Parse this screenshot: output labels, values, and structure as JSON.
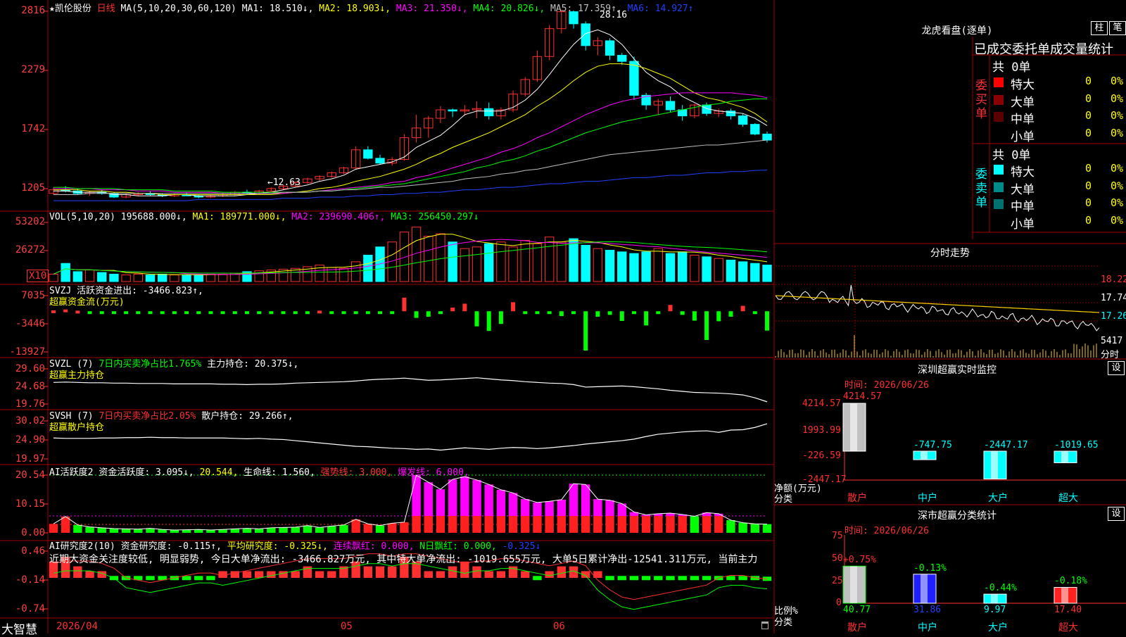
{
  "main_header": {
    "stock_name": "★凯伦股份",
    "period": "日线",
    "ma_params": "MA(5,10,20,30,60,120)",
    "ma1": "MA1: 18.510↓,",
    "ma2": "MA2: 18.903↓,",
    "ma3": "MA3: 21.350↓,",
    "ma4": "MA4: 20.826↓,",
    "ma5": "MA5: 17.359↑,",
    "ma6": "MA6: 14.927↑",
    "high_marker": "28.16",
    "low_marker": "←12.63"
  },
  "main_yaxis": [
    "2816",
    "2279",
    "1742",
    "1205"
  ],
  "vol_header": {
    "label": "VOL(5,10,20)",
    "vol": "195688.000↓,",
    "ma1": "MA1: 189771.000↓,",
    "ma2": "MA2: 239690.406↑,",
    "ma3": "MA3: 256450.297↓"
  },
  "vol_yaxis": [
    "53202",
    "26272"
  ],
  "vol_unit": "X10",
  "svzj": {
    "line1": "SVZJ  活跃资金进出: -3466.823↑,",
    "line2": "超赢资金流(万元)"
  },
  "svzj_yaxis": [
    "7035",
    "-3446",
    "-13927"
  ],
  "svzl": {
    "label": "SVZL (7)",
    "ratio": "7日内买卖净占比1.765%",
    "hold": "主力持仓: 20.375↓,",
    "line2": "超赢主力持仓"
  },
  "svzl_yaxis": [
    "29.60",
    "24.68",
    "19.76"
  ],
  "svsh": {
    "label": "SVSH (7)",
    "ratio": "7日内买卖净占比2.05%",
    "hold": "散户持仓: 29.266↑,",
    "line2": "超赢散户持仓"
  },
  "svsh_yaxis": [
    "30.02",
    "24.90",
    "19.97"
  ],
  "ai_active": {
    "label": "AI活跃度2",
    "a": "资金活跃度: 3.095↓,",
    "b": "20.544,",
    "c": "生命线: 1.560,",
    "d": "强势线: 3.000,",
    "e": "爆发线: 6.000,"
  },
  "ai_active_yaxis": [
    "20.54",
    "10.15",
    "0.00"
  ],
  "ai_research": {
    "label": "AI研究度2(10)",
    "a": "资金研究度: -0.115↑,",
    "b": "平均研究度: -0.325↓,",
    "c": "连续飘红: 0.000,",
    "d": "N日飘红: 0.000,",
    "e": "-0.325↓",
    "note": "近期大资金关注度较低, 明显弱势, 今日大单净流出: -3466.827万元, 其中特大单净流出: -1019.655万元, 大单5日累计净出-12541.311万元, 当前主力"
  },
  "ai_research_yaxis": [
    "0.46",
    "-0.14",
    "-0.74"
  ],
  "xaxis": {
    "brand": "大智慧",
    "labels": [
      "2026/04",
      "05",
      "06"
    ]
  },
  "dragon_panel": {
    "title": "龙虎看盘(逐单)",
    "btn1": "柱",
    "btn2": "笔",
    "subtitle": "已成交委托单成交量统计",
    "buy_total": "共 0单",
    "buy_label": "委买单",
    "sell_total": "共 0单",
    "sell_label": "委卖单",
    "buy_rows": [
      {
        "name": "特大",
        "count": "0",
        "pct": "0%",
        "color": "#ff0000"
      },
      {
        "name": "大单",
        "count": "0",
        "pct": "0%",
        "color": "#8b0000"
      },
      {
        "name": "中单",
        "count": "0",
        "pct": "0%",
        "color": "#5a0000"
      },
      {
        "name": "小单",
        "count": "0",
        "pct": "0%",
        "color": ""
      }
    ],
    "sell_rows": [
      {
        "name": "特大",
        "count": "0",
        "pct": "0%",
        "color": "#00ffff"
      },
      {
        "name": "大单",
        "count": "0",
        "pct": "0%",
        "color": "#008b8b"
      },
      {
        "name": "中单",
        "count": "0",
        "pct": "0%",
        "color": "#007070"
      },
      {
        "name": "小单",
        "count": "0",
        "pct": "0%",
        "color": ""
      }
    ]
  },
  "intraday": {
    "title": "分时走势",
    "yaxis": [
      "18.22",
      "17.74",
      "17.26"
    ],
    "vol_value": "5417",
    "vol_label": "分时"
  },
  "sz_monitor": {
    "title": "深圳超赢实时监控",
    "btn": "设",
    "time": "时间: 2026/06/26",
    "yaxis": [
      "4214.57",
      "1993.99",
      "-226.59",
      "-2447.17"
    ],
    "ylabel": "净额(万元)",
    "xlabel": "分类",
    "values": [
      "4214.57",
      "-747.75",
      "-2447.17",
      "-1019.65"
    ],
    "categories": [
      "散户",
      "中户",
      "大户",
      "超大"
    ]
  },
  "sz_class": {
    "title": "深市超赢分类统计",
    "btn": "设",
    "time": "时间: 2026/06/26",
    "yaxis": [
      "75",
      "50",
      "25",
      "0"
    ],
    "ylabel": "比例%",
    "xlabel": "分类",
    "changes": [
      "+0.75%",
      "-0.13%",
      "-0.44%",
      "-0.18%"
    ],
    "values": [
      "40.77",
      "31.86",
      "9.97",
      "17.40"
    ],
    "categories": [
      "散户",
      "中户",
      "大户",
      "超大"
    ]
  },
  "colors": {
    "up": "#ff3030",
    "down": "#00ffff",
    "ma1": "#ffffff",
    "ma2": "#ffff00",
    "ma3": "#ff00ff",
    "ma4": "#00ff00",
    "ma5": "#c0c0c0",
    "ma6": "#2040ff",
    "border": "#a00000"
  },
  "chart_data": {
    "type": "candlestick",
    "candles": [
      [
        13.0,
        13.5,
        12.9,
        13.3
      ],
      [
        13.3,
        13.6,
        13.1,
        13.2
      ],
      [
        13.2,
        13.4,
        12.9,
        13.0
      ],
      [
        13.0,
        13.2,
        12.8,
        13.1
      ],
      [
        13.1,
        13.3,
        12.9,
        13.0
      ],
      [
        13.0,
        13.1,
        12.63,
        12.7
      ],
      [
        12.7,
        13.0,
        12.6,
        12.9
      ],
      [
        12.9,
        13.1,
        12.8,
        13.0
      ],
      [
        13.0,
        13.2,
        12.8,
        12.9
      ],
      [
        12.9,
        13.0,
        12.7,
        12.8
      ],
      [
        12.8,
        13.0,
        12.7,
        12.9
      ],
      [
        12.9,
        13.1,
        12.8,
        12.8
      ],
      [
        12.8,
        12.9,
        12.6,
        12.7
      ],
      [
        12.7,
        12.9,
        12.63,
        12.8
      ],
      [
        12.8,
        13.0,
        12.7,
        12.9
      ],
      [
        12.9,
        13.2,
        12.8,
        13.1
      ],
      [
        13.1,
        13.3,
        12.9,
        13.0
      ],
      [
        13.0,
        13.3,
        12.9,
        13.2
      ],
      [
        13.2,
        13.5,
        13.1,
        13.4
      ],
      [
        13.4,
        13.7,
        13.3,
        13.6
      ],
      [
        13.6,
        14.0,
        13.5,
        13.9
      ],
      [
        13.9,
        14.3,
        13.8,
        14.2
      ],
      [
        14.2,
        14.5,
        14.0,
        14.4
      ],
      [
        14.4,
        14.8,
        14.3,
        14.7
      ],
      [
        14.7,
        15.2,
        14.6,
        15.1
      ],
      [
        15.1,
        16.9,
        15.0,
        16.6
      ],
      [
        16.6,
        16.9,
        15.8,
        15.9
      ],
      [
        15.9,
        16.2,
        15.4,
        15.5
      ],
      [
        15.5,
        16.0,
        15.3,
        15.8
      ],
      [
        15.8,
        17.9,
        15.7,
        17.6
      ],
      [
        17.6,
        19.5,
        17.2,
        18.4
      ],
      [
        18.4,
        19.4,
        17.6,
        19.2
      ],
      [
        19.2,
        20.2,
        18.8,
        19.9
      ],
      [
        19.9,
        20.0,
        19.3,
        19.8
      ],
      [
        19.8,
        20.3,
        19.4,
        19.9
      ],
      [
        19.9,
        20.6,
        19.2,
        20.0
      ],
      [
        20.0,
        20.5,
        19.1,
        19.4
      ],
      [
        19.4,
        20.1,
        19.1,
        19.9
      ],
      [
        19.9,
        21.5,
        19.7,
        21.2
      ],
      [
        21.2,
        22.6,
        21.0,
        22.4
      ],
      [
        22.4,
        24.8,
        22.2,
        24.3
      ],
      [
        24.3,
        26.9,
        24.0,
        26.6
      ],
      [
        26.6,
        28.16,
        26.2,
        28.0
      ],
      [
        28.0,
        28.1,
        26.6,
        27.0
      ],
      [
        27.0,
        27.2,
        24.8,
        25.2
      ],
      [
        25.2,
        25.9,
        24.4,
        25.6
      ],
      [
        25.6,
        25.8,
        24.0,
        24.4
      ],
      [
        24.4,
        24.6,
        23.6,
        23.9
      ],
      [
        23.9,
        24.3,
        20.7,
        21.1
      ],
      [
        21.1,
        21.3,
        19.9,
        20.3
      ],
      [
        20.3,
        20.8,
        19.5,
        20.6
      ],
      [
        20.6,
        21.0,
        19.7,
        19.9
      ],
      [
        19.9,
        20.3,
        19.0,
        19.4
      ],
      [
        19.4,
        20.4,
        19.2,
        20.3
      ],
      [
        20.3,
        20.5,
        19.4,
        19.6
      ],
      [
        19.6,
        20.0,
        19.3,
        19.8
      ],
      [
        19.8,
        20.0,
        19.1,
        19.4
      ],
      [
        19.4,
        19.6,
        18.5,
        18.7
      ],
      [
        18.7,
        18.8,
        17.8,
        17.9
      ],
      [
        17.9,
        18.1,
        17.2,
        17.4
      ]
    ],
    "ma": {
      "MA1": [
        13.2,
        13.2,
        13.1,
        13.1,
        13.1,
        12.9,
        12.9,
        12.8,
        12.8,
        12.8,
        12.9,
        12.9,
        12.8,
        12.8,
        12.8,
        12.8,
        12.9,
        13.0,
        13.1,
        13.3,
        13.5,
        13.7,
        14.0,
        14.2,
        14.5,
        15.0,
        15.2,
        15.4,
        15.6,
        16.0,
        16.8,
        17.3,
        17.8,
        18.6,
        19.5,
        19.8,
        19.8,
        19.8,
        20.1,
        20.7,
        21.6,
        22.8,
        24.1,
        25.3,
        26.2,
        26.5,
        26.1,
        25.3,
        24.1,
        23.0,
        22.3,
        21.8,
        21.0,
        20.5,
        20.0,
        19.8,
        19.7,
        19.6,
        19.2,
        18.6
      ],
      "MA2": [
        13.3,
        13.3,
        13.3,
        13.2,
        13.2,
        13.1,
        13.1,
        13.0,
        13.0,
        12.9,
        12.9,
        12.9,
        12.9,
        12.9,
        12.9,
        12.9,
        12.9,
        12.9,
        12.9,
        13.0,
        13.1,
        13.2,
        13.4,
        13.5,
        13.7,
        14.0,
        14.2,
        14.4,
        14.7,
        15.0,
        15.4,
        15.9,
        16.3,
        16.8,
        17.2,
        17.6,
        18.0,
        18.5,
        19.0,
        19.5,
        20.2,
        20.8,
        21.5,
        22.3,
        23.0,
        23.5,
        23.7,
        23.7,
        23.6,
        23.3,
        22.9,
        22.5,
        21.9,
        21.3,
        20.9,
        20.7,
        20.4,
        20.1,
        19.6,
        18.9
      ],
      "MA3": [
        13.4,
        13.4,
        13.4,
        13.4,
        13.3,
        13.3,
        13.3,
        13.2,
        13.2,
        13.2,
        13.1,
        13.1,
        13.1,
        13.1,
        13.0,
        13.0,
        13.0,
        13.0,
        13.0,
        13.0,
        13.1,
        13.1,
        13.2,
        13.3,
        13.4,
        13.5,
        13.6,
        13.7,
        13.9,
        14.0,
        14.3,
        14.5,
        14.8,
        15.1,
        15.4,
        15.7,
        16.0,
        16.4,
        16.7,
        17.1,
        17.6,
        18.0,
        18.5,
        19.0,
        19.5,
        19.9,
        20.3,
        20.6,
        20.8,
        21.0,
        21.1,
        21.2,
        21.3,
        21.3,
        21.3,
        21.3,
        21.3,
        21.2,
        21.1,
        20.9
      ],
      "MA4": [
        13.5,
        13.5,
        13.4,
        13.4,
        13.4,
        13.4,
        13.3,
        13.3,
        13.3,
        13.3,
        13.2,
        13.2,
        13.2,
        13.2,
        13.1,
        13.1,
        13.1,
        13.1,
        13.1,
        13.1,
        13.1,
        13.1,
        13.2,
        13.2,
        13.3,
        13.4,
        13.5,
        13.6,
        13.7,
        13.8,
        14.0,
        14.2,
        14.4,
        14.6,
        14.8,
        15.1,
        15.3,
        15.6,
        15.8,
        16.1,
        16.5,
        16.8,
        17.2,
        17.6,
        18.0,
        18.3,
        18.6,
        18.9,
        19.1,
        19.3,
        19.5,
        19.7,
        19.9,
        20.1,
        20.3,
        20.4,
        20.6,
        20.7,
        20.8,
        20.8
      ],
      "MA5": [
        12.9,
        12.9,
        12.9,
        13.0,
        13.0,
        13.0,
        13.0,
        13.0,
        13.0,
        13.0,
        13.0,
        13.0,
        13.0,
        13.0,
        13.0,
        13.0,
        13.0,
        13.0,
        13.0,
        13.1,
        13.1,
        13.1,
        13.2,
        13.2,
        13.3,
        13.3,
        13.4,
        13.5,
        13.5,
        13.6,
        13.7,
        13.8,
        13.9,
        14.0,
        14.2,
        14.3,
        14.4,
        14.6,
        14.7,
        14.9,
        15.0,
        15.2,
        15.4,
        15.6,
        15.8,
        16.0,
        16.2,
        16.3,
        16.4,
        16.5,
        16.6,
        16.7,
        16.8,
        16.9,
        17.0,
        17.0,
        17.1,
        17.2,
        17.3,
        17.4
      ],
      "MA6": [
        12.4,
        12.4,
        12.4,
        12.4,
        12.4,
        12.4,
        12.4,
        12.4,
        12.4,
        12.4,
        12.4,
        12.4,
        12.5,
        12.5,
        12.5,
        12.5,
        12.5,
        12.5,
        12.5,
        12.6,
        12.6,
        12.6,
        12.7,
        12.7,
        12.7,
        12.8,
        12.8,
        12.9,
        12.9,
        13.0,
        13.0,
        13.1,
        13.1,
        13.2,
        13.3,
        13.3,
        13.4,
        13.5,
        13.5,
        13.6,
        13.7,
        13.8,
        13.8,
        13.9,
        14.0,
        14.0,
        14.1,
        14.2,
        14.3,
        14.3,
        14.4,
        14.5,
        14.5,
        14.6,
        14.7,
        14.7,
        14.8,
        14.8,
        14.9,
        14.93
      ]
    },
    "volume": [
      9000,
      22000,
      12000,
      14000,
      11000,
      9000,
      8000,
      9000,
      8000,
      9000,
      8000,
      8000,
      8000,
      9000,
      9000,
      10000,
      12000,
      13000,
      14000,
      15000,
      16000,
      18000,
      20000,
      17000,
      16000,
      24000,
      32000,
      42000,
      48000,
      60000,
      66000,
      55000,
      58000,
      48000,
      40000,
      42000,
      46000,
      48000,
      42000,
      50000,
      46000,
      54000,
      48000,
      52000,
      44000,
      40000,
      38000,
      36000,
      34000,
      36000,
      40000,
      34000,
      36000,
      32000,
      30000,
      28000,
      26000,
      24000,
      22000,
      20000
    ],
    "ylim_price": [
      12.0,
      28.5
    ],
    "fund_flow": [
      300,
      600,
      200,
      -100,
      -400,
      -300,
      -200,
      -300,
      -100,
      -200,
      -300,
      -200,
      -400,
      -300,
      -200,
      -100,
      -200,
      -300,
      -400,
      -300,
      -200,
      -100,
      200,
      -100,
      -200,
      -300,
      -400,
      -300,
      -500,
      4500,
      -2200,
      -1800,
      -700,
      1200,
      2500,
      -5000,
      -6500,
      -4200,
      3000,
      -100,
      -200,
      -400,
      -1600,
      -200,
      -13000,
      -1800,
      -1200,
      -3200,
      -800,
      -4700,
      -200,
      2100,
      -1200,
      -3100,
      -9500,
      -3300,
      -1800,
      1800,
      -300,
      -6400,
      -3466
    ],
    "main_hold": [
      25.8,
      25.9,
      25.8,
      25.7,
      25.7,
      25.6,
      25.6,
      25.5,
      25.5,
      25.5,
      25.4,
      25.4,
      25.4,
      25.4,
      25.3,
      25.3,
      25.2,
      25.3,
      25.3,
      25.4,
      25.6,
      25.7,
      25.8,
      25.9,
      26.0,
      26.2,
      26.5,
      26.7,
      26.8,
      27.0,
      26.7,
      26.4,
      26.5,
      26.7,
      26.9,
      27.1,
      26.8,
      26.5,
      26.3,
      26.0,
      25.8,
      25.6,
      25.5,
      25.2,
      24.5,
      24.6,
      24.7,
      24.8,
      24.6,
      24.3,
      24.0,
      23.6,
      23.3,
      23.0,
      22.9,
      22.8,
      22.6,
      22.3,
      21.5,
      20.375
    ],
    "retail_hold": [
      25.5,
      25.4,
      25.4,
      25.4,
      25.5,
      25.5,
      25.6,
      25.6,
      25.7,
      25.6,
      25.6,
      25.5,
      25.5,
      25.5,
      25.5,
      25.4,
      25.3,
      25.4,
      25.2,
      25.1,
      24.8,
      24.5,
      24.2,
      23.9,
      23.6,
      23.3,
      23.2,
      23.0,
      22.8,
      22.7,
      22.5,
      22.6,
      22.3,
      22.6,
      22.9,
      22.7,
      22.5,
      22.8,
      23.0,
      22.9,
      22.7,
      22.9,
      23.2,
      23.5,
      23.9,
      24.2,
      24.5,
      24.8,
      25.2,
      25.9,
      26.5,
      26.8,
      27.1,
      27.3,
      27.4,
      27.0,
      27.6,
      27.7,
      28.3,
      29.266
    ],
    "activity": [
      3.2,
      5.8,
      2.8,
      2.1,
      1.8,
      1.5,
      1.4,
      1.3,
      1.6,
      1.2,
      1.0,
      1.1,
      1.2,
      1.0,
      1.2,
      1.4,
      1.6,
      1.4,
      1.8,
      1.9,
      2.0,
      2.6,
      1.9,
      2.4,
      2.8,
      4.8,
      3.2,
      2.6,
      3.4,
      3.8,
      20.5,
      18.0,
      15.5,
      19.0,
      20.0,
      18.8,
      17.2,
      15.3,
      14.2,
      12.0,
      10.8,
      11.2,
      11.8,
      17.5,
      17.2,
      12.0,
      11.6,
      10.4,
      7.4,
      6.4,
      6.8,
      7.0,
      6.5,
      5.9,
      7.2,
      6.8,
      4.5,
      3.6,
      3.2,
      3.095
    ],
    "research": [
      0.2,
      0.3,
      0.1,
      0.0,
      0.0,
      -0.1,
      -0.1,
      -0.1,
      -0.1,
      -0.1,
      -0.1,
      -0.1,
      -0.1,
      -0.1,
      0.0,
      0.0,
      0.0,
      0.0,
      0.0,
      0.0,
      0.0,
      0.1,
      0.0,
      0.0,
      0.1,
      0.2,
      0.1,
      0.1,
      0.1,
      0.3,
      0.2,
      0.0,
      0.0,
      0.1,
      0.2,
      0.1,
      0.0,
      0.0,
      0.1,
      0.0,
      -0.1,
      0.0,
      0.1,
      0.1,
      0.0,
      0.0,
      -0.1,
      -0.1,
      -0.1,
      -0.1,
      -0.1,
      -0.1,
      -0.1,
      -0.1,
      -0.1,
      -0.1,
      -0.1,
      -0.1,
      -0.1,
      -0.115
    ],
    "research_avg": [
      0.0,
      0.05,
      0.05,
      0.05,
      0.0,
      -0.1,
      -0.3,
      -0.35,
      -0.4,
      -0.35,
      -0.3,
      -0.25,
      -0.2,
      -0.2,
      -0.25,
      -0.2,
      -0.15,
      -0.1,
      -0.05,
      0.0,
      0.05,
      0.1,
      0.1,
      0.1,
      0.1,
      0.15,
      0.2,
      0.2,
      0.15,
      0.2,
      0.2,
      0.15,
      0.1,
      0.05,
      0.0,
      0.05,
      0.05,
      0.1,
      0.1,
      0.05,
      0.0,
      -0.05,
      0.0,
      0.05,
      -0.05,
      -0.35,
      -0.55,
      -0.7,
      -0.75,
      -0.7,
      -0.65,
      -0.6,
      -0.55,
      -0.5,
      -0.45,
      -0.3,
      -0.25,
      -0.25,
      -0.3,
      -0.325
    ]
  }
}
